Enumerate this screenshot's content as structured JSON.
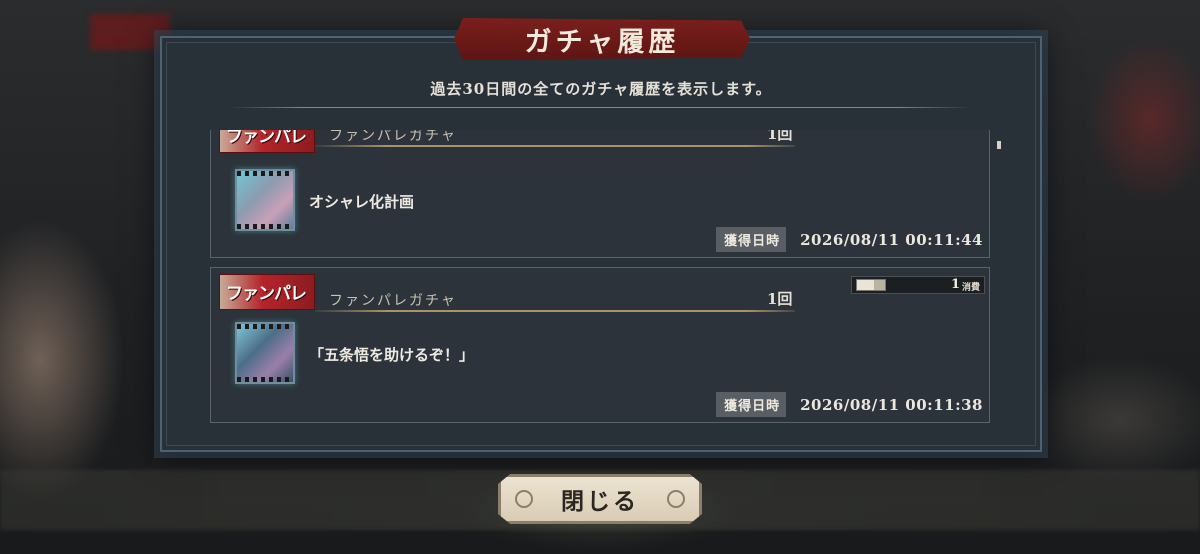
{
  "dialog": {
    "title": "ガチャ履歴",
    "subtitle": "過去30日間の全てのガチャ履歴を表示します。",
    "close_label": "閉じる"
  },
  "entries": [
    {
      "banner_text": "ファンパレ",
      "gacha_name": "ファンパレガチャ",
      "count": "1回",
      "item_name": "オシャレ化計画",
      "acquired_label": "獲得日時",
      "acquired_time": "2026/08/11 00:11:44"
    },
    {
      "banner_text": "ファンパレ",
      "gacha_name": "ファンパレガチャ",
      "count": "1回",
      "cost_num": "1",
      "cost_unit": "消費",
      "item_name": "「五条悟を助けるぞ！」",
      "acquired_label": "獲得日時",
      "acquired_time": "2026/08/11 00:11:38"
    }
  ],
  "colors": {
    "title_banner": "#7a1f1c",
    "dialog_bg": "#283038",
    "card_bg": "#2c333a",
    "gold_line": "#a89466",
    "close_button": "#ece3d2"
  }
}
